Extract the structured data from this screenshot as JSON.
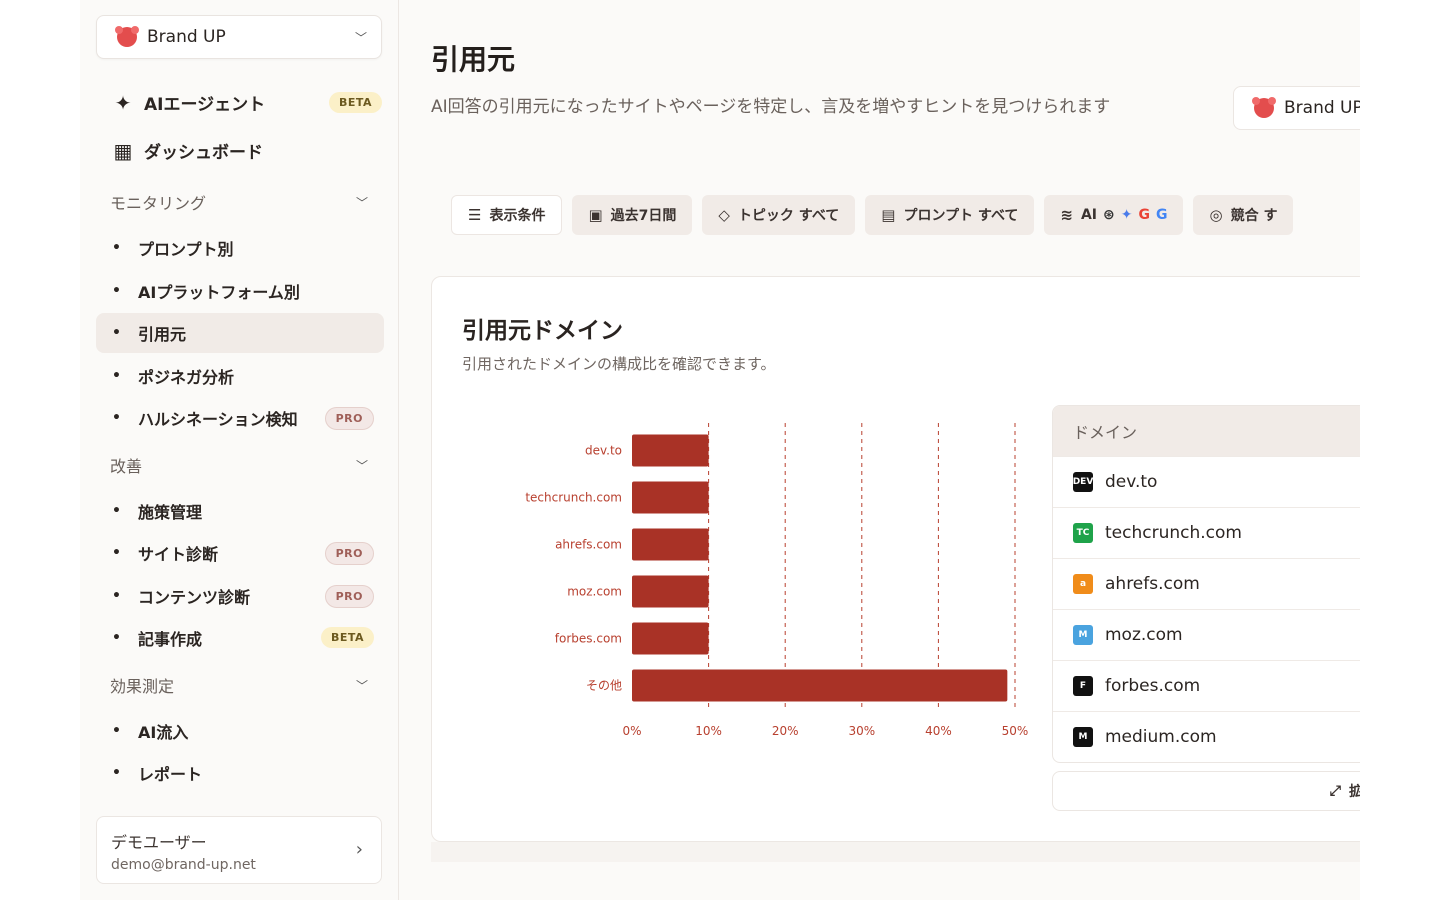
{
  "sidebar": {
    "brand": "Brand UP",
    "primary": [
      {
        "label": "AIエージェント",
        "badge": "BETA"
      },
      {
        "label": "ダッシュボード"
      }
    ],
    "sections": [
      {
        "label": "モニタリング",
        "items": [
          {
            "label": "プロンプト別"
          },
          {
            "label": "AIプラットフォーム別"
          },
          {
            "label": "引用元",
            "active": true
          },
          {
            "label": "ポジネガ分析"
          },
          {
            "label": "ハルシネーション検知",
            "badge": "PRO"
          }
        ]
      },
      {
        "label": "改善",
        "items": [
          {
            "label": "施策管理"
          },
          {
            "label": "サイト診断",
            "badge": "PRO"
          },
          {
            "label": "コンテンツ診断",
            "badge": "PRO"
          },
          {
            "label": "記事作成",
            "badge": "BETA"
          }
        ]
      },
      {
        "label": "効果測定",
        "items": [
          {
            "label": "AI流入"
          },
          {
            "label": "レポート"
          }
        ]
      }
    ],
    "user": {
      "name": "デモユーザー",
      "email": "demo@brand-up.net"
    }
  },
  "header": {
    "title": "引用元",
    "description": "AI回答の引用元になったサイトやページを特定し、言及を増やすヒントを見つけられます",
    "brand_button": "Brand UP"
  },
  "filters": {
    "conditions": "表示条件",
    "period": "過去7日間",
    "topic": "トピック すべて",
    "prompt": "プロンプト すべて",
    "ai": "AI",
    "competitor": "競合 す"
  },
  "card": {
    "title": "引用元ドメイン",
    "subtitle": "引用されたドメインの構成比を確認できます。",
    "table_header": "ドメイン",
    "expand": "拡大す"
  },
  "domains": [
    {
      "name": "dev.to",
      "icon": "dev-to-icon",
      "color": "#111111",
      "mark": "DEV"
    },
    {
      "name": "techcrunch.com",
      "icon": "techcrunch-icon",
      "color": "#1fa34a",
      "mark": "TC"
    },
    {
      "name": "ahrefs.com",
      "icon": "ahrefs-icon",
      "color": "#f08c1a",
      "mark": "a"
    },
    {
      "name": "moz.com",
      "icon": "moz-icon",
      "color": "#4aa3df",
      "mark": "M"
    },
    {
      "name": "forbes.com",
      "icon": "forbes-icon",
      "color": "#111111",
      "mark": "F"
    },
    {
      "name": "medium.com",
      "icon": "medium-icon",
      "color": "#111111",
      "mark": "M"
    }
  ],
  "chart_data": {
    "type": "bar",
    "orientation": "horizontal",
    "categories": [
      "dev.to",
      "techcrunch.com",
      "ahrefs.com",
      "moz.com",
      "forbes.com",
      "その他"
    ],
    "values": [
      10,
      10,
      10,
      10,
      10,
      49
    ],
    "xticks": [
      "0%",
      "10%",
      "20%",
      "30%",
      "40%",
      "50%"
    ],
    "xlim": [
      0,
      50
    ],
    "bar_color": "#a93226",
    "grid": "dashed-vertical"
  }
}
